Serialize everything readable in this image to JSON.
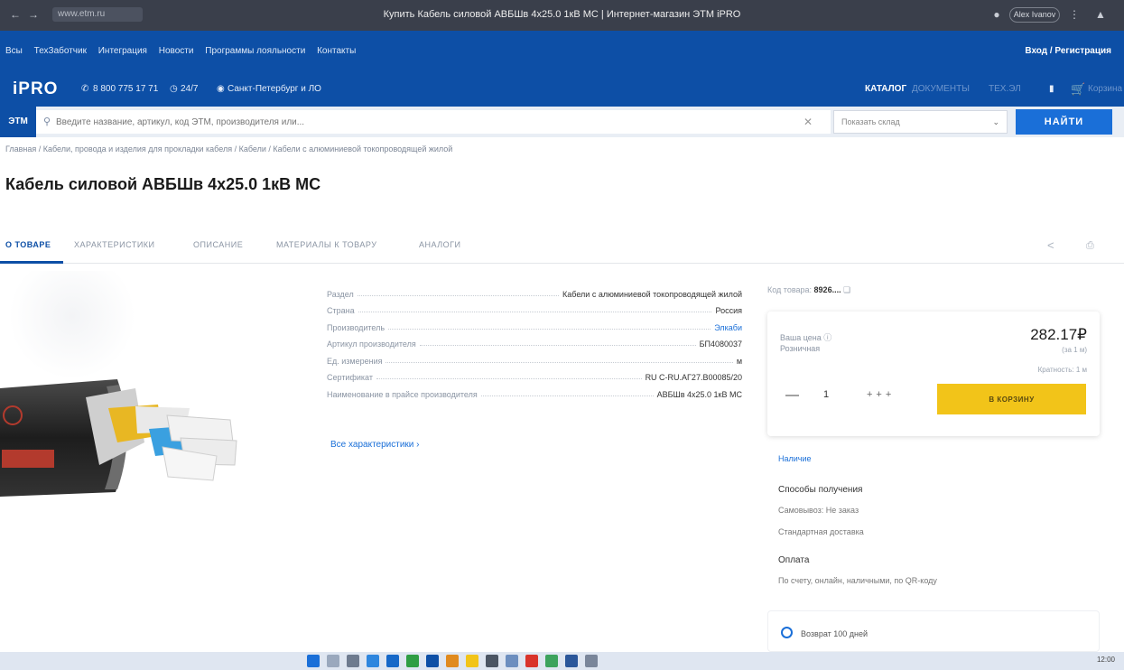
{
  "browser": {
    "address_short": "www.etm.ru",
    "window_title": "Купить Кабель силовой АВБШв 4х25.0 1кВ МС | Интернет-магазин ЭТМ iPRO",
    "user_label": "Alex Ivanov"
  },
  "topnav": {
    "links": [
      "Bcы",
      "ТехЗаботчик",
      "Интеграция",
      "Новости",
      "Программы лояльности",
      "Контакты"
    ],
    "login": "Вход / Регистрация"
  },
  "header": {
    "logo": "iPRO",
    "phone": "8 800 775 17 71",
    "support": "24/7",
    "city": "Санкт-Петербург и ЛО",
    "catalog": "КАТАЛОГ",
    "nav_faded": [
      "ДОКУМЕНТЫ",
      "ТЕХ.ЭЛ"
    ],
    "cart": "Корзина"
  },
  "search": {
    "tab": "ЭТМ",
    "placeholder": "Введите название, артикул, код ЭТМ, производителя или...",
    "select_placeholder": "Показать склад",
    "find_label": "НАЙТИ"
  },
  "breadcrumb": "Главная / Кабели, провода и изделия для прокладки кабеля / Кабели / Кабели с алюминиевой токопроводящей жилой",
  "title": "Кабель силовой АВБШв 4х25.0 1кВ МС",
  "tabs": [
    "О ТОВАРЕ",
    "ХАРАКТЕРИСТИКИ",
    "ОПИСАНИЕ",
    "МАТЕРИАЛЫ К ТОВАРУ",
    "АНАЛОГИ"
  ],
  "specs": [
    {
      "k": "Раздел",
      "v": "Кабели с алюминиевой токопроводящей жилой",
      "link": false
    },
    {
      "k": "Страна",
      "v": "Россия",
      "link": false
    },
    {
      "k": "Производитель",
      "v": "Элкаби",
      "link": true
    },
    {
      "k": "Артикул производителя",
      "v": "БП4080037",
      "link": false
    },
    {
      "k": "Ед. измерения",
      "v": "м",
      "link": false
    },
    {
      "k": "Сертификат",
      "v": "RU C-RU.АГ27.В00085/20",
      "link": false
    },
    {
      "k": "Наименование в прайсе производителя",
      "v": "АВБШв 4х25.0 1кВ МС",
      "link": false
    }
  ],
  "all_specs": "Все характеристики",
  "article": {
    "label": "Код товара:",
    "value": "8926...."
  },
  "buybox": {
    "label_price": "Ваша цена",
    "label_retail": "Розничная",
    "price": "282.17₽",
    "price_sub": "(за 1 м)",
    "unit": "Кратность: 1 м",
    "qty": "1",
    "cart_button": "В КОРЗИНУ"
  },
  "availability": "Наличие",
  "receive": {
    "title": "Способы получения",
    "lines": [
      "Самовывоз: Не заказ",
      "Стандартная доставка"
    ]
  },
  "pay": {
    "title": "Оплата",
    "text": "По счету, онлайн, наличными, по QR-коду"
  },
  "returns": "Возврат 100 дней",
  "taskbar": {
    "clock": "12:00"
  }
}
